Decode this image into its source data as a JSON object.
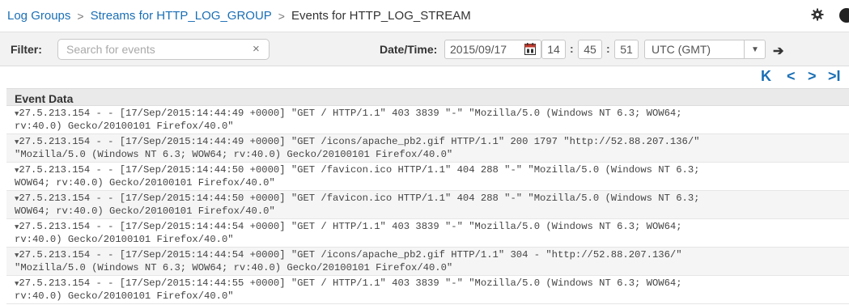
{
  "breadcrumb": {
    "log_groups": "Log Groups",
    "streams": "Streams for HTTP_LOG_GROUP",
    "events": "Events for HTTP_LOG_STREAM",
    "separator": ">"
  },
  "filter": {
    "label": "Filter:",
    "placeholder": "Search for events",
    "value": "",
    "clear_icon": "×"
  },
  "datetime": {
    "label": "Date/Time:",
    "date": "2015/09/17",
    "hour": "14",
    "minute": "45",
    "second": "51",
    "colon": ":",
    "timezone": "UTC (GMT)",
    "go_icon": "➔"
  },
  "pager": {
    "first": "K",
    "prev": "<",
    "next": ">",
    "last": ">I"
  },
  "table": {
    "header": "Event Data"
  },
  "events": [
    {
      "line1": "27.5.213.154 - - [17/Sep/2015:14:44:49 +0000] \"GET / HTTP/1.1\" 403 3839 \"-\" \"Mozilla/5.0 (Windows NT 6.3; WOW64;",
      "line2": "rv:40.0) Gecko/20100101 Firefox/40.0\""
    },
    {
      "line1": "27.5.213.154 - - [17/Sep/2015:14:44:49 +0000] \"GET /icons/apache_pb2.gif HTTP/1.1\" 200 1797 \"http://52.88.207.136/\"",
      "line2": "\"Mozilla/5.0 (Windows NT 6.3; WOW64; rv:40.0) Gecko/20100101 Firefox/40.0\""
    },
    {
      "line1": "27.5.213.154 - - [17/Sep/2015:14:44:50 +0000] \"GET /favicon.ico HTTP/1.1\" 404 288 \"-\" \"Mozilla/5.0 (Windows NT 6.3;",
      "line2": "WOW64; rv:40.0) Gecko/20100101 Firefox/40.0\""
    },
    {
      "line1": "27.5.213.154 - - [17/Sep/2015:14:44:50 +0000] \"GET /favicon.ico HTTP/1.1\" 404 288 \"-\" \"Mozilla/5.0 (Windows NT 6.3;",
      "line2": "WOW64; rv:40.0) Gecko/20100101 Firefox/40.0\""
    },
    {
      "line1": "27.5.213.154 - - [17/Sep/2015:14:44:54 +0000] \"GET / HTTP/1.1\" 403 3839 \"-\" \"Mozilla/5.0 (Windows NT 6.3; WOW64;",
      "line2": "rv:40.0) Gecko/20100101 Firefox/40.0\""
    },
    {
      "line1": "27.5.213.154 - - [17/Sep/2015:14:44:54 +0000] \"GET /icons/apache_pb2.gif HTTP/1.1\" 304 - \"http://52.88.207.136/\"",
      "line2": "\"Mozilla/5.0 (Windows NT 6.3; WOW64; rv:40.0) Gecko/20100101 Firefox/40.0\""
    },
    {
      "line1": "27.5.213.154 - - [17/Sep/2015:14:44:55 +0000] \"GET / HTTP/1.1\" 403 3839 \"-\" \"Mozilla/5.0 (Windows NT 6.3; WOW64;",
      "line2": "rv:40.0) Gecko/20100101 Firefox/40.0\""
    }
  ],
  "icons": {
    "settings": "gear-icon",
    "help": "help-icon",
    "calendar": "calendar-icon",
    "expand": "caret-down-icon",
    "row_caret": "▼"
  },
  "colors": {
    "link": "#1a6fb5",
    "toolbar_bg": "#f2f2f2",
    "header_bg": "#eaeaea"
  }
}
